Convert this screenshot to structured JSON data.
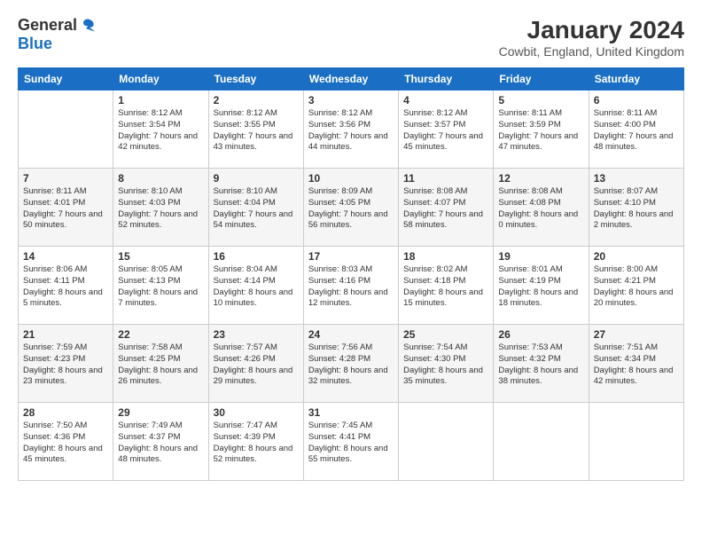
{
  "logo": {
    "general": "General",
    "blue": "Blue"
  },
  "title": "January 2024",
  "subtitle": "Cowbit, England, United Kingdom",
  "days_of_week": [
    "Sunday",
    "Monday",
    "Tuesday",
    "Wednesday",
    "Thursday",
    "Friday",
    "Saturday"
  ],
  "weeks": [
    [
      {
        "date": "",
        "sunrise": "",
        "sunset": "",
        "daylight": ""
      },
      {
        "date": "1",
        "sunrise": "Sunrise: 8:12 AM",
        "sunset": "Sunset: 3:54 PM",
        "daylight": "Daylight: 7 hours and 42 minutes."
      },
      {
        "date": "2",
        "sunrise": "Sunrise: 8:12 AM",
        "sunset": "Sunset: 3:55 PM",
        "daylight": "Daylight: 7 hours and 43 minutes."
      },
      {
        "date": "3",
        "sunrise": "Sunrise: 8:12 AM",
        "sunset": "Sunset: 3:56 PM",
        "daylight": "Daylight: 7 hours and 44 minutes."
      },
      {
        "date": "4",
        "sunrise": "Sunrise: 8:12 AM",
        "sunset": "Sunset: 3:57 PM",
        "daylight": "Daylight: 7 hours and 45 minutes."
      },
      {
        "date": "5",
        "sunrise": "Sunrise: 8:11 AM",
        "sunset": "Sunset: 3:59 PM",
        "daylight": "Daylight: 7 hours and 47 minutes."
      },
      {
        "date": "6",
        "sunrise": "Sunrise: 8:11 AM",
        "sunset": "Sunset: 4:00 PM",
        "daylight": "Daylight: 7 hours and 48 minutes."
      }
    ],
    [
      {
        "date": "7",
        "sunrise": "Sunrise: 8:11 AM",
        "sunset": "Sunset: 4:01 PM",
        "daylight": "Daylight: 7 hours and 50 minutes."
      },
      {
        "date": "8",
        "sunrise": "Sunrise: 8:10 AM",
        "sunset": "Sunset: 4:03 PM",
        "daylight": "Daylight: 7 hours and 52 minutes."
      },
      {
        "date": "9",
        "sunrise": "Sunrise: 8:10 AM",
        "sunset": "Sunset: 4:04 PM",
        "daylight": "Daylight: 7 hours and 54 minutes."
      },
      {
        "date": "10",
        "sunrise": "Sunrise: 8:09 AM",
        "sunset": "Sunset: 4:05 PM",
        "daylight": "Daylight: 7 hours and 56 minutes."
      },
      {
        "date": "11",
        "sunrise": "Sunrise: 8:08 AM",
        "sunset": "Sunset: 4:07 PM",
        "daylight": "Daylight: 7 hours and 58 minutes."
      },
      {
        "date": "12",
        "sunrise": "Sunrise: 8:08 AM",
        "sunset": "Sunset: 4:08 PM",
        "daylight": "Daylight: 8 hours and 0 minutes."
      },
      {
        "date": "13",
        "sunrise": "Sunrise: 8:07 AM",
        "sunset": "Sunset: 4:10 PM",
        "daylight": "Daylight: 8 hours and 2 minutes."
      }
    ],
    [
      {
        "date": "14",
        "sunrise": "Sunrise: 8:06 AM",
        "sunset": "Sunset: 4:11 PM",
        "daylight": "Daylight: 8 hours and 5 minutes."
      },
      {
        "date": "15",
        "sunrise": "Sunrise: 8:05 AM",
        "sunset": "Sunset: 4:13 PM",
        "daylight": "Daylight: 8 hours and 7 minutes."
      },
      {
        "date": "16",
        "sunrise": "Sunrise: 8:04 AM",
        "sunset": "Sunset: 4:14 PM",
        "daylight": "Daylight: 8 hours and 10 minutes."
      },
      {
        "date": "17",
        "sunrise": "Sunrise: 8:03 AM",
        "sunset": "Sunset: 4:16 PM",
        "daylight": "Daylight: 8 hours and 12 minutes."
      },
      {
        "date": "18",
        "sunrise": "Sunrise: 8:02 AM",
        "sunset": "Sunset: 4:18 PM",
        "daylight": "Daylight: 8 hours and 15 minutes."
      },
      {
        "date": "19",
        "sunrise": "Sunrise: 8:01 AM",
        "sunset": "Sunset: 4:19 PM",
        "daylight": "Daylight: 8 hours and 18 minutes."
      },
      {
        "date": "20",
        "sunrise": "Sunrise: 8:00 AM",
        "sunset": "Sunset: 4:21 PM",
        "daylight": "Daylight: 8 hours and 20 minutes."
      }
    ],
    [
      {
        "date": "21",
        "sunrise": "Sunrise: 7:59 AM",
        "sunset": "Sunset: 4:23 PM",
        "daylight": "Daylight: 8 hours and 23 minutes."
      },
      {
        "date": "22",
        "sunrise": "Sunrise: 7:58 AM",
        "sunset": "Sunset: 4:25 PM",
        "daylight": "Daylight: 8 hours and 26 minutes."
      },
      {
        "date": "23",
        "sunrise": "Sunrise: 7:57 AM",
        "sunset": "Sunset: 4:26 PM",
        "daylight": "Daylight: 8 hours and 29 minutes."
      },
      {
        "date": "24",
        "sunrise": "Sunrise: 7:56 AM",
        "sunset": "Sunset: 4:28 PM",
        "daylight": "Daylight: 8 hours and 32 minutes."
      },
      {
        "date": "25",
        "sunrise": "Sunrise: 7:54 AM",
        "sunset": "Sunset: 4:30 PM",
        "daylight": "Daylight: 8 hours and 35 minutes."
      },
      {
        "date": "26",
        "sunrise": "Sunrise: 7:53 AM",
        "sunset": "Sunset: 4:32 PM",
        "daylight": "Daylight: 8 hours and 38 minutes."
      },
      {
        "date": "27",
        "sunrise": "Sunrise: 7:51 AM",
        "sunset": "Sunset: 4:34 PM",
        "daylight": "Daylight: 8 hours and 42 minutes."
      }
    ],
    [
      {
        "date": "28",
        "sunrise": "Sunrise: 7:50 AM",
        "sunset": "Sunset: 4:36 PM",
        "daylight": "Daylight: 8 hours and 45 minutes."
      },
      {
        "date": "29",
        "sunrise": "Sunrise: 7:49 AM",
        "sunset": "Sunset: 4:37 PM",
        "daylight": "Daylight: 8 hours and 48 minutes."
      },
      {
        "date": "30",
        "sunrise": "Sunrise: 7:47 AM",
        "sunset": "Sunset: 4:39 PM",
        "daylight": "Daylight: 8 hours and 52 minutes."
      },
      {
        "date": "31",
        "sunrise": "Sunrise: 7:45 AM",
        "sunset": "Sunset: 4:41 PM",
        "daylight": "Daylight: 8 hours and 55 minutes."
      },
      {
        "date": "",
        "sunrise": "",
        "sunset": "",
        "daylight": ""
      },
      {
        "date": "",
        "sunrise": "",
        "sunset": "",
        "daylight": ""
      },
      {
        "date": "",
        "sunrise": "",
        "sunset": "",
        "daylight": ""
      }
    ]
  ]
}
